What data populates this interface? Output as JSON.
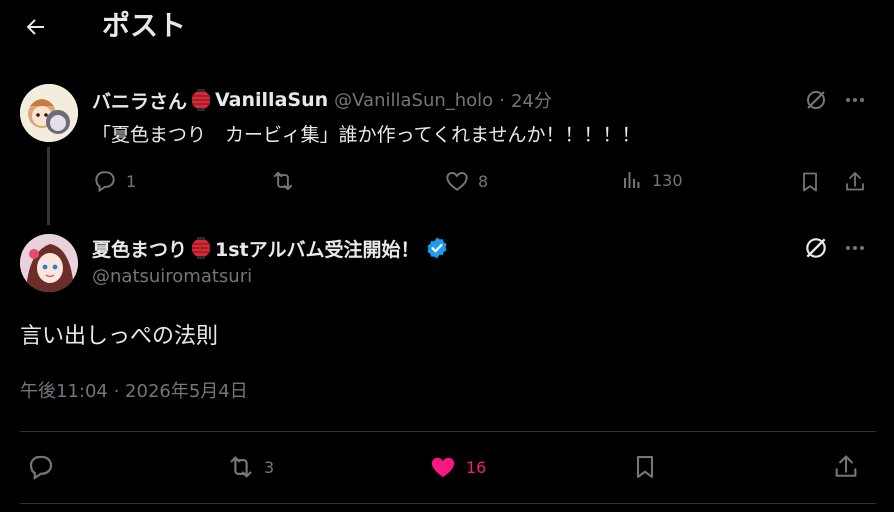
{
  "header": {
    "title": "ポスト",
    "back_icon": "arrow-left-icon"
  },
  "reply_to": {
    "display_name_before": "バニラさん",
    "display_name_after": "VanillaSun",
    "handle": "@VanillaSun_holo",
    "separator": "·",
    "time_ago": "24分",
    "text": "「夏色まつり　カービィ集」誰か作ってくれませんか！！！！！",
    "actions": {
      "reply_count": "1",
      "retweet_count": "",
      "like_count": "8",
      "view_count": "130"
    }
  },
  "post": {
    "display_name_before": "夏色まつり",
    "display_name_after": "1stアルバム受注開始！",
    "handle": "@natsuiromatsuri",
    "text": "言い出しっぺの法則",
    "timestamp": "午後11:04 · 2026年5月4日",
    "actions": {
      "reply_count": "",
      "retweet_count": "3",
      "like_count": "16",
      "liked": true
    }
  },
  "colors": {
    "background": "#000000",
    "text_primary": "#e7e9ea",
    "text_secondary": "#71767b",
    "like_active": "#f91880",
    "verified_blue": "#1d9bf0",
    "divider": "#2f3336"
  }
}
